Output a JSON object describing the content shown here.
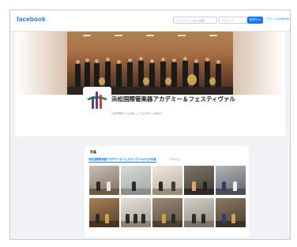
{
  "header": {
    "logo": "facebook",
    "email_placeholder": "メールアドレスまたは電話",
    "password_placeholder": "パスワード",
    "login_label": "ログイン",
    "signup_label": "アカウントを作成の作成"
  },
  "profile": {
    "title": "浜松国際管楽器アカデミー＆フェスティヴァル",
    "meta": "1,097件の「いいね！」・フォロワー1,095人"
  },
  "photos": {
    "heading": "写真",
    "tabs": [
      {
        "label": "浜松国際管楽器アカデミー＆フェスティヴァルからの写真",
        "active": true
      },
      {
        "label": "アルバム",
        "active": false
      }
    ],
    "items": [
      {
        "name": "photo-1"
      },
      {
        "name": "photo-2"
      },
      {
        "name": "photo-3"
      },
      {
        "name": "photo-4"
      },
      {
        "name": "photo-5"
      },
      {
        "name": "photo-6"
      },
      {
        "name": "photo-7"
      },
      {
        "name": "photo-8"
      },
      {
        "name": "photo-9"
      },
      {
        "name": "photo-10"
      }
    ]
  },
  "colors": {
    "brand": "#1877f2",
    "background": "#f0f2f5",
    "avatar_green": "#1f8f4a",
    "avatar_purple": "#5a3f8a",
    "avatar_red": "#d83a2e"
  }
}
